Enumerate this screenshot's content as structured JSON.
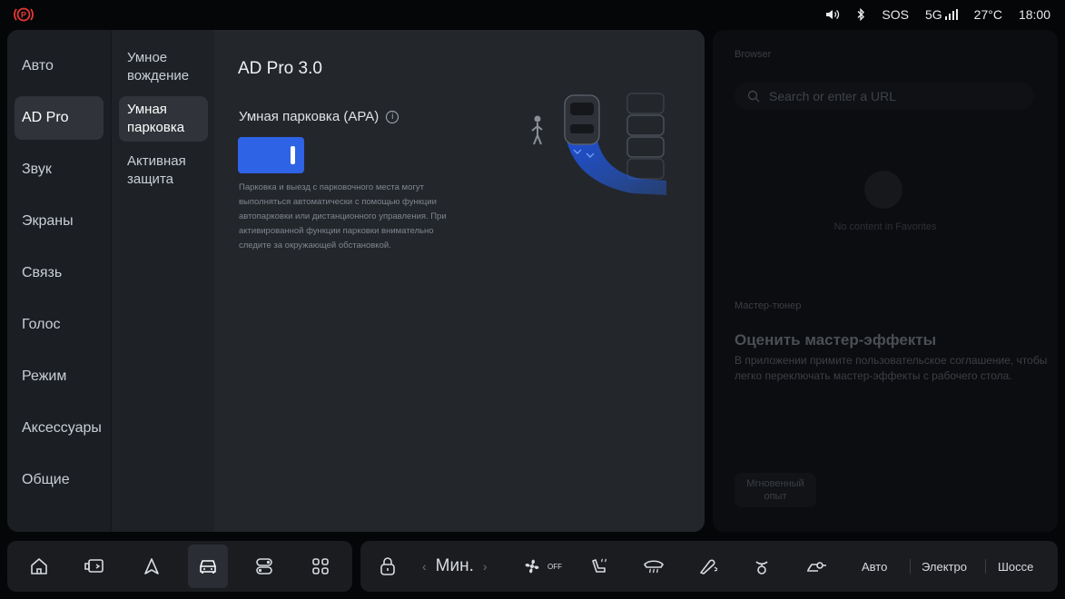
{
  "status_bar": {
    "volume_icon": "volume-icon",
    "bluetooth_icon": "bluetooth-icon",
    "sos": "SOS",
    "network": "5G",
    "temperature": "27°C",
    "time": "18:00"
  },
  "nav_primary": [
    {
      "label": "Авто",
      "active": false
    },
    {
      "label": "AD Pro",
      "active": true
    },
    {
      "label": "Звук",
      "active": false
    },
    {
      "label": "Экраны",
      "active": false
    },
    {
      "label": "Связь",
      "active": false
    },
    {
      "label": "Голос",
      "active": false
    },
    {
      "label": "Режим",
      "active": false
    },
    {
      "label": "Аксессуары",
      "active": false
    },
    {
      "label": "Общие",
      "active": false
    }
  ],
  "nav_secondary": [
    {
      "label": "Умное вождение",
      "active": false
    },
    {
      "label": "Умная парковка",
      "active": true
    },
    {
      "label": "Активная защита",
      "active": false
    }
  ],
  "content": {
    "title": "AD Pro 3.0",
    "feature_title": "Умная парковка (APA)",
    "toggle_on": true,
    "description": "Парковка и выезд с парковочного места могут выполняться автоматически с помощью функции автопарковки или дистанционного управления. При активированной функции парковки внимательно следите за окружающей обстановкой."
  },
  "right_panel": {
    "browser_label": "Browser",
    "search_placeholder": "Search or enter a URL",
    "empty_text": "No content in Favorites",
    "tuner_label": "Мастер-тюнер",
    "heading": "Оценить мастер-эффекты",
    "text": "В приложении примите пользовательское соглашение, чтобы легко переключать мастер-эффекты с рабочего стола.",
    "chip": "Мгновенный опыт"
  },
  "dock": {
    "left_icons": [
      "home-icon",
      "display-icon",
      "navigation-icon",
      "car-icon",
      "climate-controls-icon",
      "apps-grid-icon"
    ],
    "active_index": 3,
    "fan_mode": "Мин.",
    "fan_off": "OFF",
    "modes": [
      "Авто",
      "Электро",
      "Шоссе"
    ]
  },
  "colors": {
    "accent": "#2f63e6",
    "panel": "#1b1e23",
    "background": "#050608"
  }
}
